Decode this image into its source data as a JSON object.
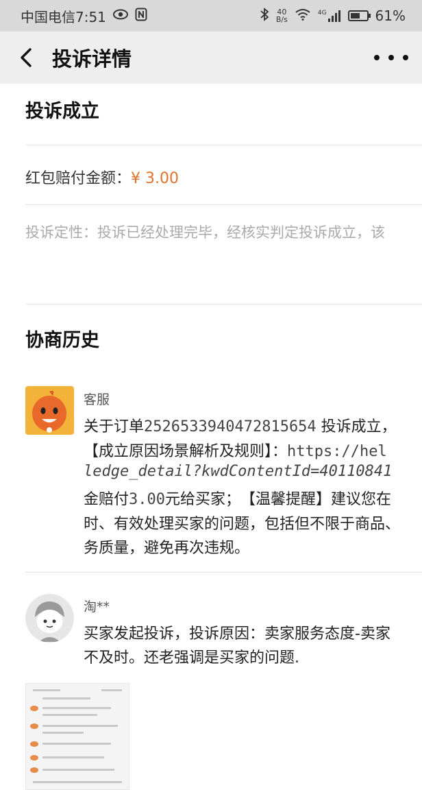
{
  "status_bar": {
    "carrier_time": "中国电信7:51",
    "net_speed_value": "40",
    "net_speed_unit": "B/s",
    "signal_label": "4G",
    "battery": "61%",
    "battery_level": 0.61
  },
  "nav": {
    "title": "投诉详情"
  },
  "result": {
    "title": "投诉成立",
    "compensation_label": "红包赔付金额：",
    "compensation_value": "¥ 3.00",
    "verdict": "投诉定性：投诉已经处理完毕，经核实判定投诉成立，该"
  },
  "history": {
    "title": "协商历史",
    "messages": [
      {
        "sender": "客服",
        "lines": [
          "关于订单",
          "2526533940472815654",
          " 投诉成立，",
          "【成立原因场景解析及规则】：",
          "https://hel",
          "ledge_detail?kwdContentId=40110841",
          "金赔付",
          "3.00",
          "元给买家；　【温馨提醒】建议您在",
          "时、有效处理买家的问题，包括但不限于商品、",
          "务质量，避免再次违规。"
        ]
      },
      {
        "sender": "淘**",
        "lines": [
          "买家发起投诉，投诉原因：卖家服务态度-卖家",
          "不及时。还老强调是买家的问题."
        ]
      }
    ]
  },
  "icons": {
    "back": "back-arrow-icon",
    "more": "more-dots-icon",
    "eye": "eye-icon",
    "nfc": "nfc-icon",
    "bluetooth": "bluetooth-icon",
    "wifi": "wifi-icon",
    "signal": "signal-icon",
    "battery": "battery-icon"
  },
  "colors": {
    "status_bar_bg": "#d9d9d9",
    "nav_bg": "#eeeeee",
    "money": "#e0712a",
    "verdict_text": "#aaaaaa"
  }
}
